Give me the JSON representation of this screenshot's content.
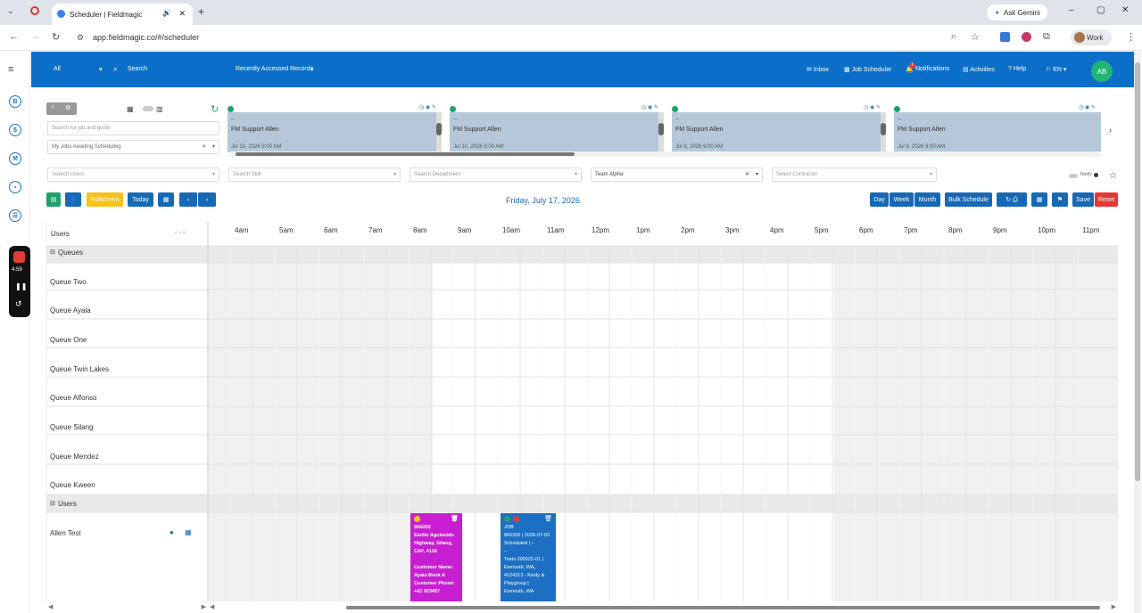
{
  "browser": {
    "tab_title": "Scheduler | Fieldmagic",
    "url": "app.fieldmagic.co/#/scheduler",
    "gemini": "Ask Gemini",
    "profile": "Work"
  },
  "header": {
    "scope": "All",
    "search": "Search",
    "recent": "Recently Accessed Records",
    "inbox": "Inbox",
    "job_scheduler": "Job Scheduler",
    "notifications": "Notifications",
    "notif_count": "1",
    "activities": "Activities",
    "help": "Help",
    "lang": "EN",
    "avatar": "AB"
  },
  "recorder": {
    "time": "4:59"
  },
  "filters": {
    "search_job": "Search for job and quote",
    "jobs_filter": "My Jobs Awaiting Scheduling",
    "search_users": "Search Users",
    "search_skill": "Search Skill",
    "search_department": "Search Department",
    "team": "Team Alpha",
    "contractor": "Select Contractor",
    "notify": "Notify"
  },
  "cards": [
    {
      "line1": "--",
      "name": "FM Support Allen",
      "date": "Jul 10, 2026 9:00 AM"
    },
    {
      "line1": "--",
      "name": "FM Support Allen",
      "date": "Jul 10, 2026 9:00 AM"
    },
    {
      "line1": "--",
      "name": "FM Support Allen",
      "date": "Jul 9, 2026 9:00 AM"
    },
    {
      "line1": "--",
      "name": "FM Support Allen",
      "date": "Jul 9, 2026 9:00 AM"
    }
  ],
  "toolbar": {
    "fullscreen": "Fullscreen",
    "today": "Today",
    "date": "Friday, July 17, 2026",
    "day": "Day",
    "week": "Week",
    "month": "Month",
    "bulk": "Bulk Schedule",
    "save": "Save",
    "reset": "Reset"
  },
  "grid": {
    "users_header": "Users",
    "hours": [
      "4am",
      "5am",
      "6am",
      "7am",
      "8am",
      "9am",
      "10am",
      "11am",
      "12pm",
      "1pm",
      "2pm",
      "3pm",
      "4pm",
      "5pm",
      "6pm",
      "7pm",
      "8pm",
      "9pm",
      "10pm",
      "11pm"
    ],
    "queues_group": "Queues",
    "queues": [
      "Queue Two",
      "Queue Ayala",
      "Queue One",
      "Queue Twin Lakes",
      "Queue Alfonso",
      "Queue Silang",
      "Queue Mendez",
      "Queue Kween"
    ],
    "users_group": "Users",
    "users": [
      "Allen Test"
    ]
  },
  "jobs": [
    {
      "lines": [
        "S66202",
        "Emilio Aguinaldo Highway, Silang, CAV, 4118",
        "",
        "Customer Name: Ayala Book A",
        "Customer Phone: +63 923457"
      ],
      "color": "#c81ed1"
    },
    {
      "lines": [
        "JOB",
        "866300 | 2026-07-03",
        "Scheduled | --",
        "--",
        "Testo 200525-01 | Exmouth, WA, 4124313 - Kindy & Playgroup |",
        "Exmouth, WA"
      ],
      "color": "#1d6fc4"
    }
  ]
}
